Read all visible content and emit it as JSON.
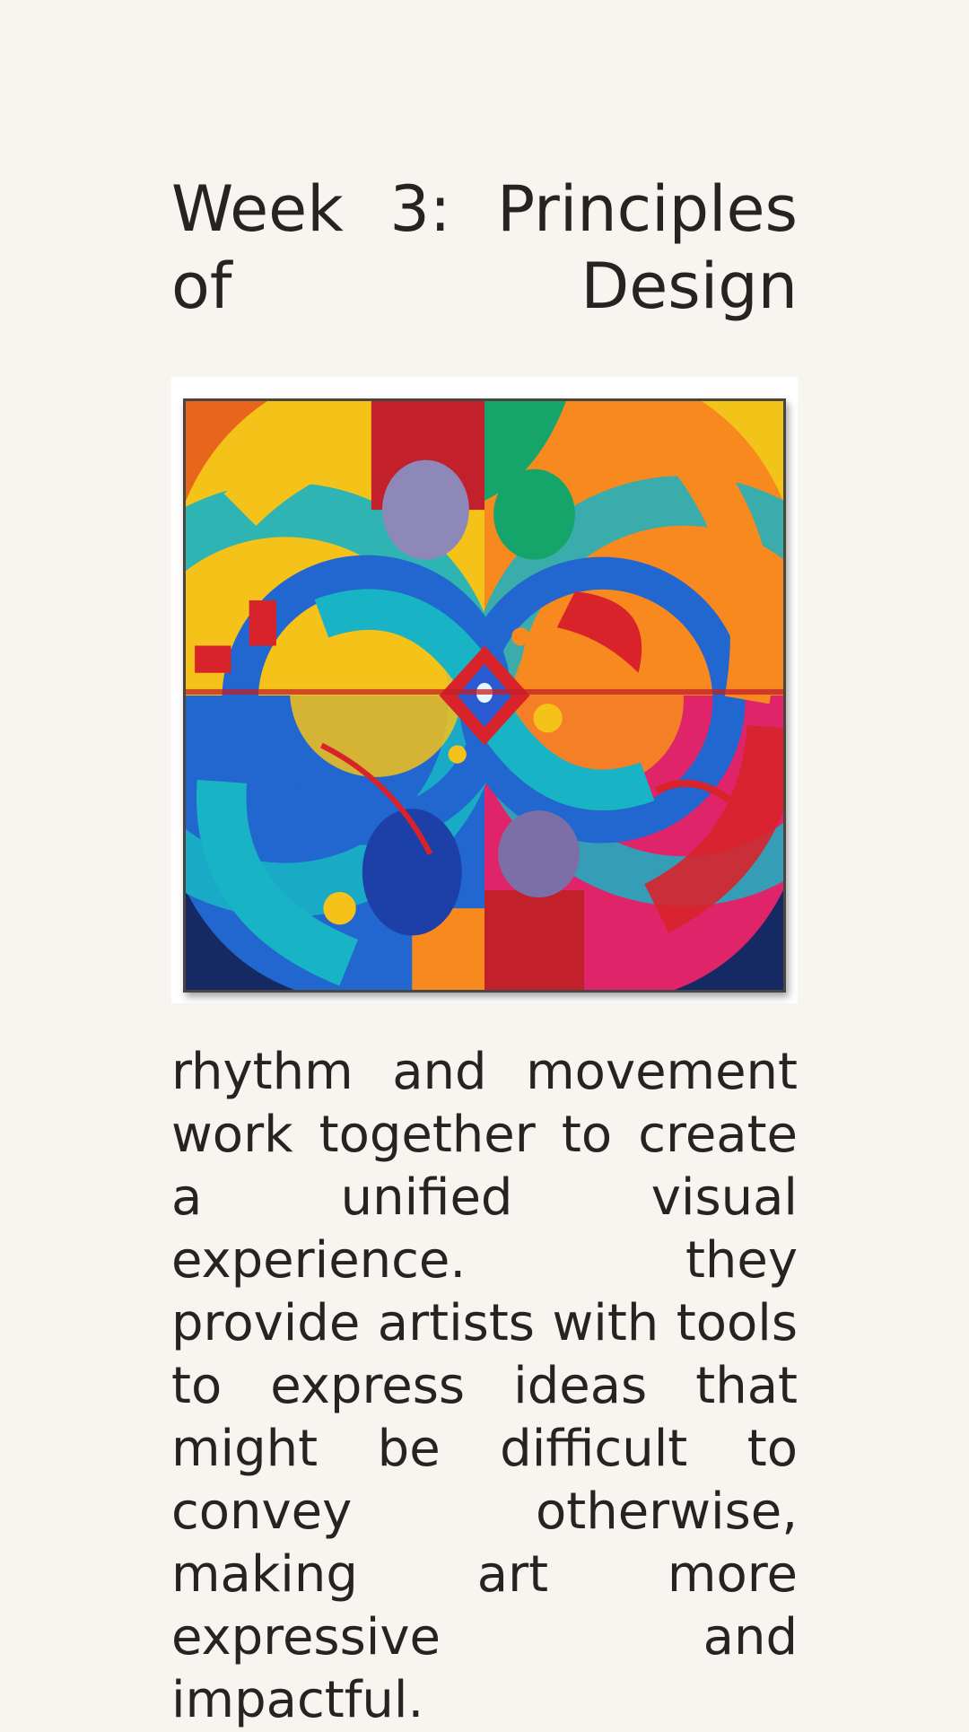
{
  "page": {
    "title": "Week 3: Principles of Design",
    "body": "rhythm and movement work together to create a unified visual experience. they provide artists with tools to express ideas that might be difficult to convey otherwise, making art more expressive and impactful."
  },
  "artwork": {
    "colors": {
      "yellow": "#f5c21a",
      "orange": "#f7891f",
      "red": "#d9232b",
      "teal": "#18b3c4",
      "blue": "#2266d0",
      "navy": "#152a62",
      "magenta": "#e0246a",
      "green": "#15a56a",
      "lavender": "#8e88b8",
      "page_background": "#f7f5ef",
      "text": "#262322"
    }
  }
}
